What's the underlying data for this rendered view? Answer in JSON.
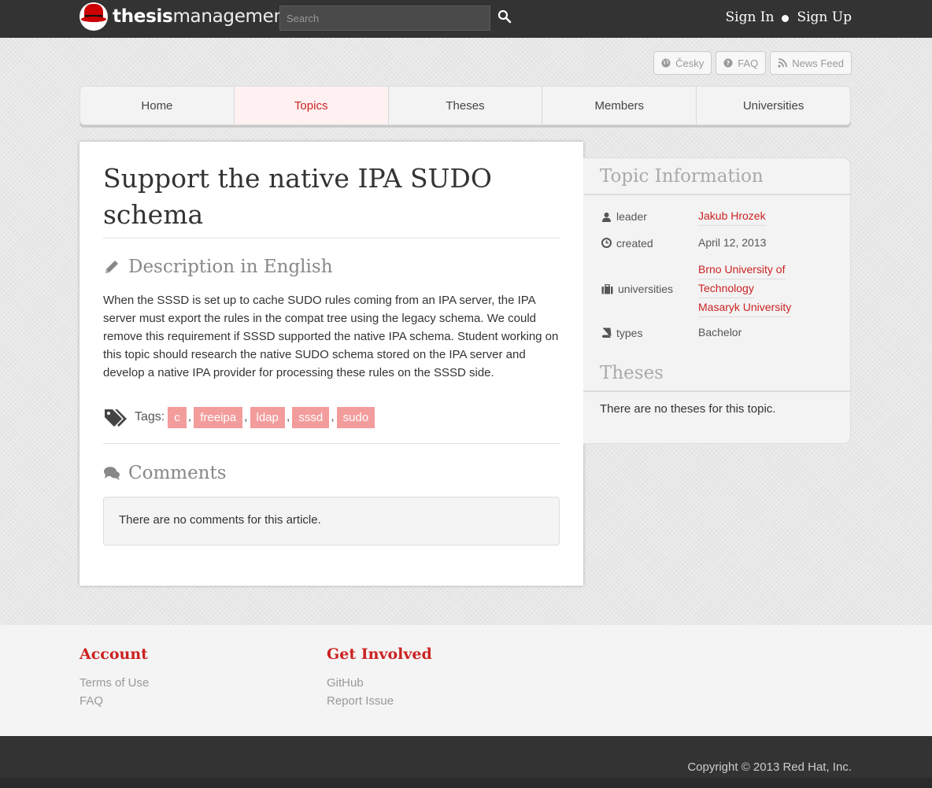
{
  "header": {
    "logo_bold": "thesis",
    "logo_light": "management",
    "search_placeholder": "Search",
    "sign_in": "Sign In",
    "sign_up": "Sign Up"
  },
  "utility": [
    {
      "label": "Česky",
      "icon": "globe-icon"
    },
    {
      "label": "FAQ",
      "icon": "question-circle-icon"
    },
    {
      "label": "News Feed",
      "icon": "rss-icon"
    }
  ],
  "nav": {
    "tabs": [
      {
        "label": "Home",
        "active": false
      },
      {
        "label": "Topics",
        "active": true
      },
      {
        "label": "Theses",
        "active": false
      },
      {
        "label": "Members",
        "active": false
      },
      {
        "label": "Universities",
        "active": false
      }
    ]
  },
  "topic": {
    "title": "Support the native IPA SUDO schema",
    "description_heading": "Description in English",
    "description": "When the SSSD is set up to cache SUDO rules coming from an IPA server, the IPA server must export the rules in the compat tree using the legacy schema. We could remove this requirement if SSSD supported the native IPA schema. Student working on this topic should research the native SUDO schema stored on the IPA server and develop a native IPA provider for processing these rules on the SSSD side.",
    "tags_label": "Tags:",
    "tags": [
      "c",
      "freeipa",
      "ldap",
      "sssd",
      "sudo"
    ],
    "comments_heading": "Comments",
    "no_comments": "There are no comments for this article."
  },
  "sidebar": {
    "info_heading": "Topic Information",
    "leader_label": "leader",
    "leader": "Jakub Hrozek",
    "created_label": "created",
    "created": "April 12, 2013",
    "universities_label": "universities",
    "university_1a": "Brno University of",
    "university_1b": "Technology",
    "university_2": "Masaryk University",
    "types_label": "types",
    "types": "Bachelor",
    "theses_heading": "Theses",
    "no_theses": "There are no theses for this topic."
  },
  "footer": {
    "account_heading": "Account",
    "account_links": [
      "Terms of Use",
      "FAQ"
    ],
    "involved_heading": "Get Involved",
    "involved_links": [
      "GitHub",
      "Report Issue"
    ],
    "copyright": "Copyright © 2013 Red Hat, Inc."
  },
  "colors": {
    "brand_red": "#cc2222",
    "tag_pink": "#f39c9c",
    "topbar": "#333333"
  }
}
